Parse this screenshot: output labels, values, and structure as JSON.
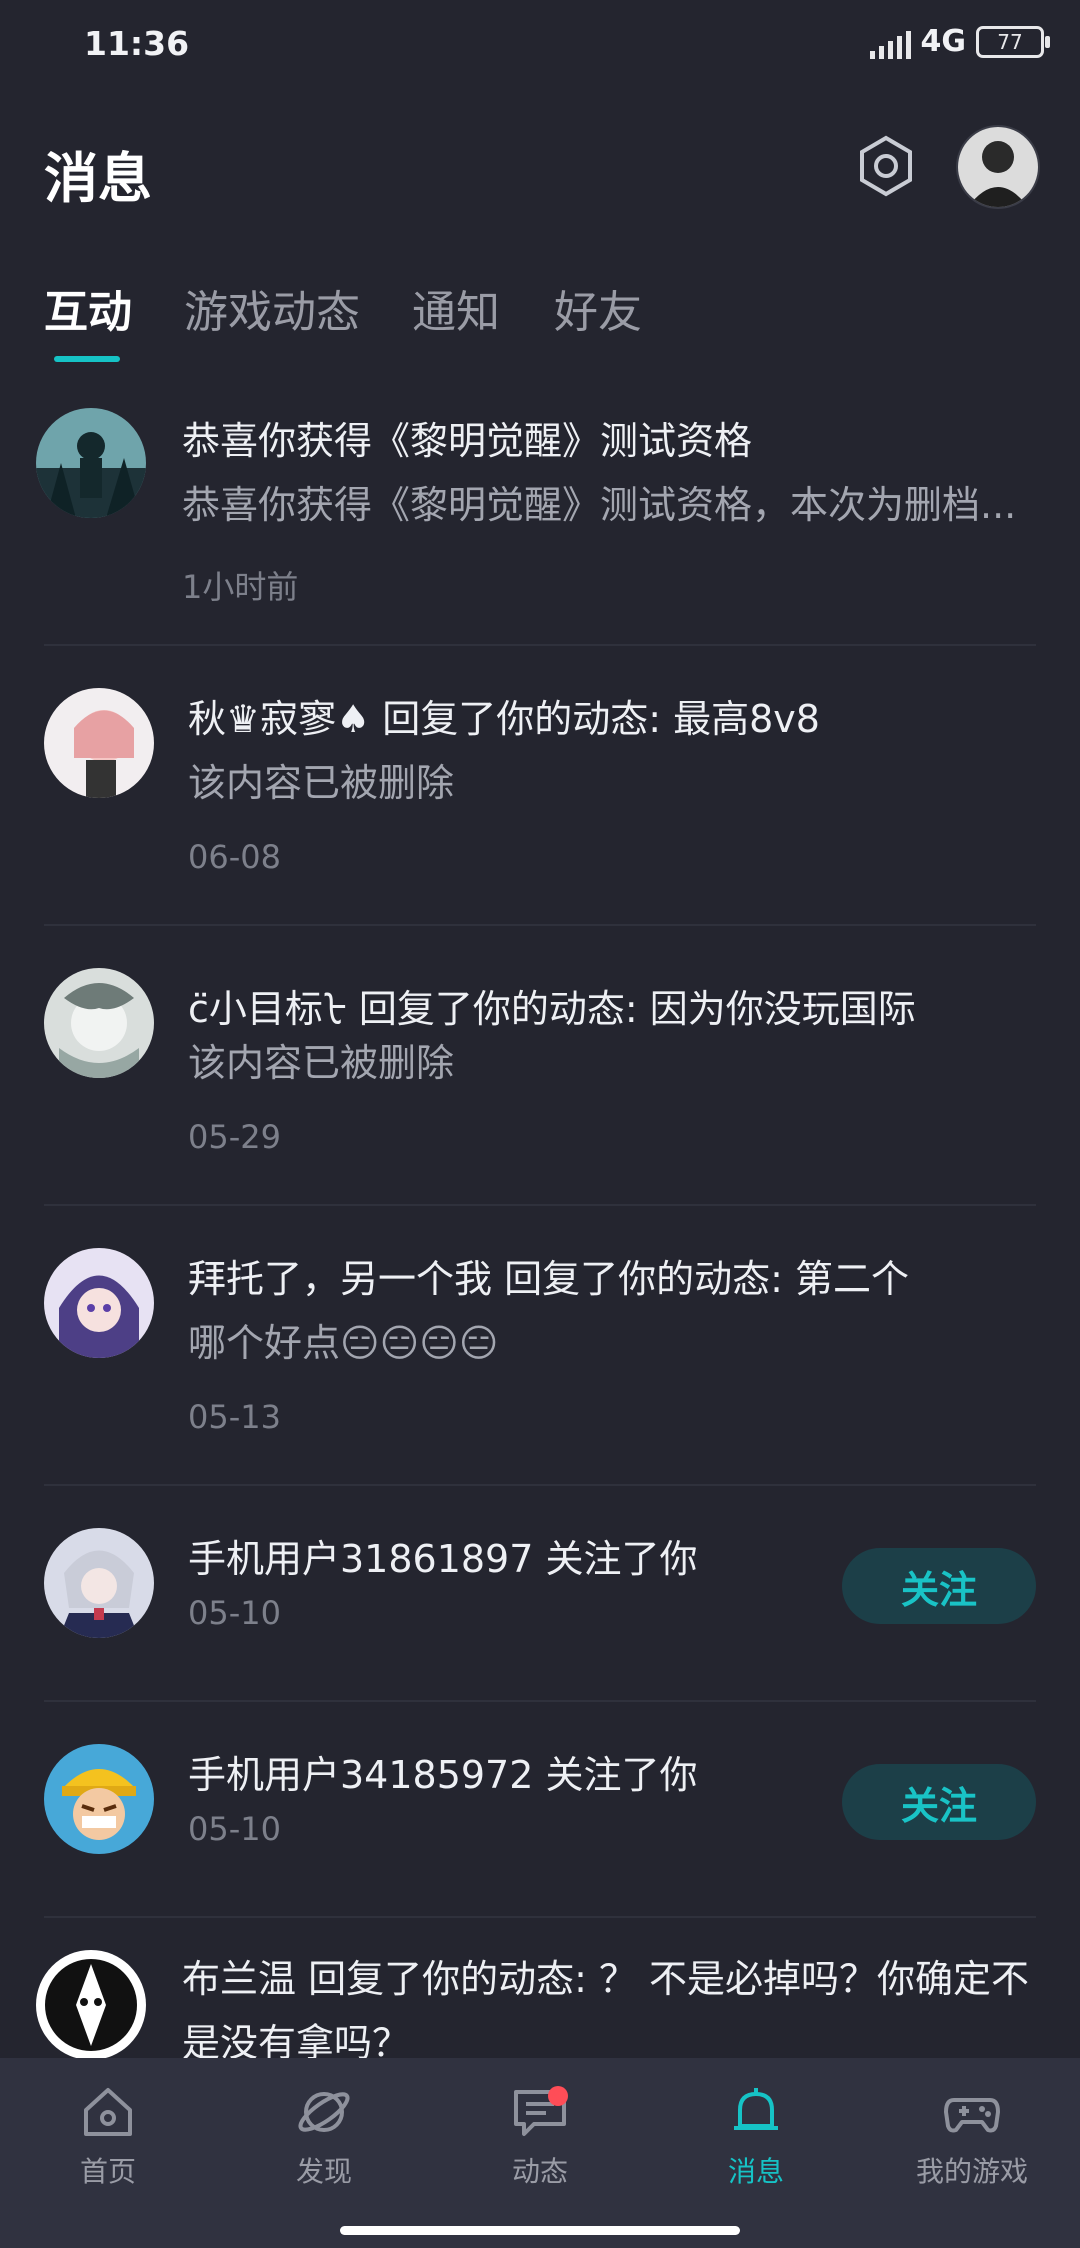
{
  "status_bar": {
    "time": "11:36",
    "network": "4G",
    "battery": "77"
  },
  "header": {
    "title": "消息",
    "settings_icon": "hexagon-gear-icon"
  },
  "tabs": [
    {
      "label": "互动",
      "active": true
    },
    {
      "label": "游戏动态",
      "active": false
    },
    {
      "label": "通知",
      "active": false
    },
    {
      "label": "好友",
      "active": false
    }
  ],
  "messages": [
    {
      "title": "恭喜你获得《黎明觉醒》测试资格",
      "body": "恭喜你获得《黎明觉醒》测试资格，本次为删档...",
      "time": "1小时前"
    },
    {
      "title": "秋♛寂寥♠ 回复了你的动态: 最高8v8",
      "body": "该内容已被删除",
      "time": "06-08"
    },
    {
      "title": "c̈小目标ᡶ 回复了你的动态: 因为你没玩国际",
      "body": "该内容已被删除",
      "time": "05-29"
    },
    {
      "title": "拜托了，另一个我 回复了你的动态: 第二个",
      "body": "哪个好点😑😑😑😑",
      "time": "05-13"
    },
    {
      "title": "手机用户31861897 关注了你",
      "time": "05-10",
      "action": "关注"
    },
    {
      "title": "手机用户34185972 关注了你",
      "time": "05-10",
      "action": "关注"
    },
    {
      "title": "布兰温 回复了你的动态: ？ 不是必掉吗？你确定不",
      "body": "是没有拿吗？"
    }
  ],
  "bottom_nav": [
    {
      "label": "首页",
      "icon": "home-icon",
      "active": false
    },
    {
      "label": "发现",
      "icon": "planet-icon",
      "active": false
    },
    {
      "label": "动态",
      "icon": "chat-icon",
      "active": false,
      "badge": true
    },
    {
      "label": "消息",
      "icon": "bell-icon",
      "active": true
    },
    {
      "label": "我的游戏",
      "icon": "gamepad-icon",
      "active": false
    }
  ],
  "colors": {
    "accent": "#16c3c6",
    "background": "#24252f",
    "badge": "#ff4d57"
  }
}
